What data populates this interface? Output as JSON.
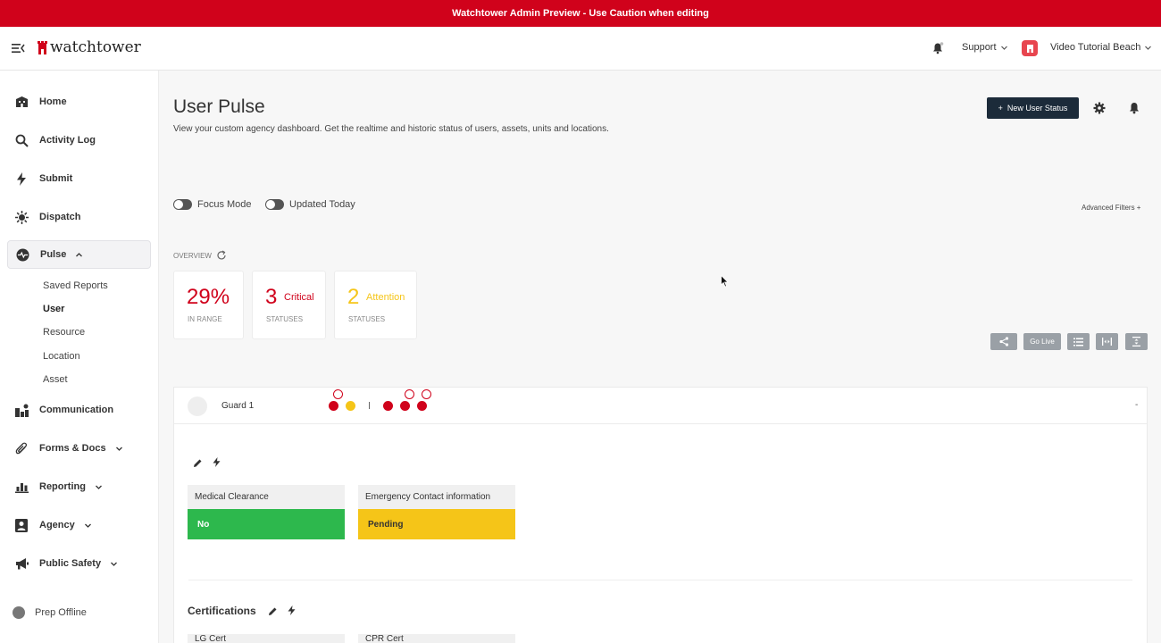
{
  "banner": {
    "text": "Watchtower Admin Preview - Use Caution when editing"
  },
  "header": {
    "logo_text": "watchtower",
    "support_label": "Support",
    "agency_name": "Video Tutorial Beach"
  },
  "sidebar": {
    "items": [
      {
        "label": "Home",
        "icon": "home-icon"
      },
      {
        "label": "Activity Log",
        "icon": "search-icon"
      },
      {
        "label": "Submit",
        "icon": "bolt-icon"
      },
      {
        "label": "Dispatch",
        "icon": "siren-icon"
      },
      {
        "label": "Pulse",
        "icon": "pulse-icon"
      },
      {
        "label": "Communication",
        "icon": "communication-icon"
      },
      {
        "label": "Forms & Docs",
        "icon": "paperclip-icon"
      },
      {
        "label": "Reporting",
        "icon": "chart-icon"
      },
      {
        "label": "Agency",
        "icon": "badge-icon"
      },
      {
        "label": "Public Safety",
        "icon": "megaphone-icon"
      }
    ],
    "pulse_subitems": [
      "Saved Reports",
      "User",
      "Resource",
      "Location",
      "Asset"
    ],
    "prep_offline": "Prep Offline"
  },
  "page": {
    "title": "User Pulse",
    "description": "View your custom agency dashboard. Get the realtime and historic status of users, assets, units and locations.",
    "new_status_label": "New User Status",
    "focus_mode_label": "Focus Mode",
    "updated_today_label": "Updated Today",
    "advanced_filters_label": "Advanced Filters +",
    "overview_label": "OVERVIEW"
  },
  "stats": {
    "in_range_value": "29%",
    "in_range_label": "IN RANGE",
    "critical_value": "3",
    "critical_label": "Critical",
    "critical_sub": "STATUSES",
    "attention_value": "2",
    "attention_label": "Attention",
    "attention_sub": "STATUSES"
  },
  "toolbar": {
    "go_live_label": "Go Live"
  },
  "user_panel": {
    "name": "Guard 1",
    "collapse_label": "-",
    "fields": [
      {
        "label": "Medical Clearance",
        "value": "No"
      },
      {
        "label": "Emergency Contact information",
        "value": "Pending"
      }
    ],
    "certifications_title": "Certifications",
    "cert_fields": [
      "LG Cert",
      "CPR Cert"
    ]
  },
  "colors": {
    "brand_red": "#d0021b",
    "critical": "#d0021b",
    "attention": "#f5c518",
    "ok_green": "#2db84d",
    "navy": "#1c2b3a"
  }
}
